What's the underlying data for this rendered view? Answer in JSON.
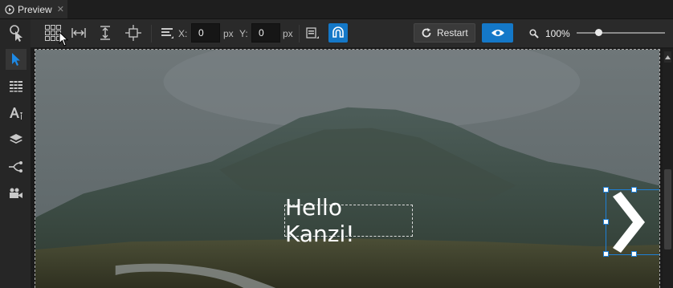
{
  "tab": {
    "label": "Preview"
  },
  "toolbar": {
    "x_label": "X:",
    "x_value": "0",
    "x_unit": "px",
    "y_label": "Y:",
    "y_value": "0",
    "y_unit": "px",
    "restart_label": "Restart",
    "zoom_value": "100%",
    "zoom_slider_fraction": 0.25
  },
  "preview": {
    "hello_text": "Hello Kanzi!"
  },
  "colors": {
    "accent": "#1478c8",
    "selection": "#1e7fd6"
  }
}
